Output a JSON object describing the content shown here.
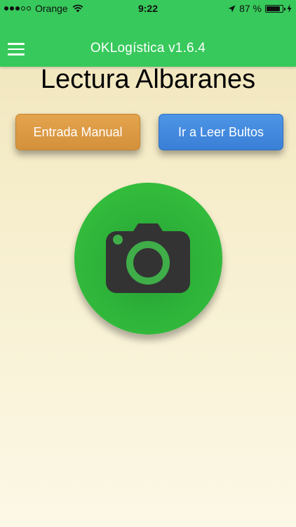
{
  "status_bar": {
    "carrier": "Orange",
    "time": "9:22",
    "battery_percent": "87 %",
    "battery_level": 0.87,
    "signal_bars_filled": 3,
    "signal_bars_total": 5,
    "icons": [
      "wifi-icon",
      "location-arrow-icon",
      "battery-icon",
      "charging-bolt-icon"
    ]
  },
  "nav": {
    "title": "OKLogística v1.6.4",
    "menu_icon": "hamburger-menu-icon",
    "color": "#37c95b"
  },
  "page": {
    "title": "Lectura Albaranes"
  },
  "buttons": {
    "manual_label": "Entrada Manual",
    "manual_color": "#dc9a45",
    "bultos_label": "Ir a Leer Bultos",
    "bultos_color": "#4488df"
  },
  "scan": {
    "icon": "camera-icon",
    "color": "#39c53f"
  }
}
